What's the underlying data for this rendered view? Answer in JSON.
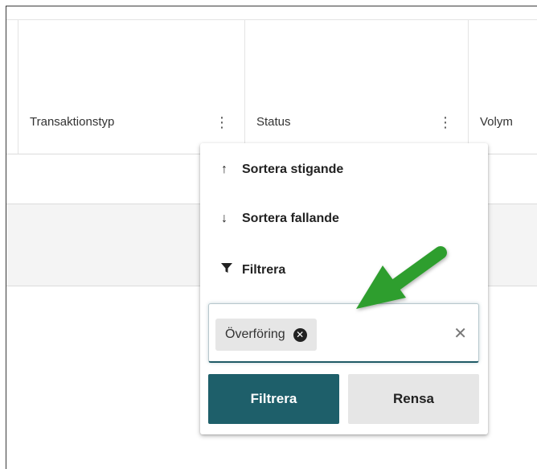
{
  "table": {
    "columns": [
      {
        "label": "Transaktionstyp",
        "menu_icon": "kebab-icon"
      },
      {
        "label": "Status",
        "menu_icon": "kebab-icon"
      },
      {
        "label": "Volym"
      }
    ]
  },
  "column_menu": {
    "sort_asc": {
      "icon": "arrow-up-icon",
      "glyph": "↑",
      "label": "Sortera stigande"
    },
    "sort_desc": {
      "icon": "arrow-down-icon",
      "glyph": "↓",
      "label": "Sortera fallande"
    },
    "filter": {
      "icon": "funnel-icon",
      "label": "Filtrera"
    },
    "filter_input": {
      "chips": [
        {
          "label": "Överföring",
          "remove_icon": "close-circle-icon"
        }
      ],
      "clear_icon": "close-icon",
      "clear_glyph": "✕"
    },
    "apply_button": "Filtrera",
    "reset_button": "Rensa"
  },
  "annotation": {
    "color": "#2f9e2f",
    "icon": "arrow-pointer-icon"
  },
  "colors": {
    "primary_button": "#1e5f6a",
    "secondary_button": "#e6e6e6",
    "row_alt_background": "#f4f4f4"
  }
}
